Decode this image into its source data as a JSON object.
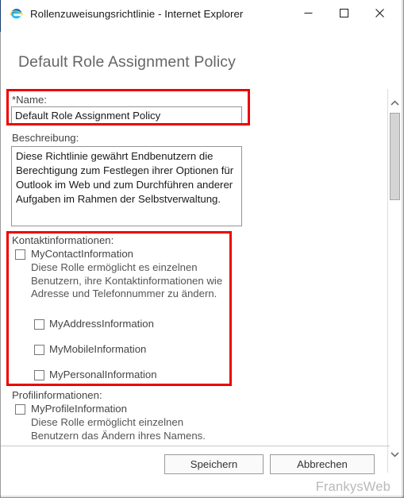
{
  "window": {
    "title": "Rollenzuweisungsrichtlinie - Internet Explorer",
    "icon": "internet-explorer-icon",
    "controls": {
      "minimize": "—",
      "maximize": "□",
      "close": "✕"
    }
  },
  "page": {
    "heading": "Default Role Assignment Policy"
  },
  "form": {
    "name": {
      "label": "*Name:",
      "value": "Default Role Assignment Policy",
      "placeholder": ""
    },
    "description": {
      "label": "Beschreibung:",
      "value": "Diese Richtlinie gewährt Endbenutzern die Berechtigung zum Festlegen ihrer Optionen für Outlook im Web und zum Durchführen anderer Aufgaben im Rahmen der Selbstverwaltung.",
      "placeholder": ""
    }
  },
  "sections": [
    {
      "label": "Kontaktinformationen:",
      "items": [
        {
          "name": "MyContactInformation",
          "checked": false,
          "description": "Diese Rolle ermöglicht es einzelnen Benutzern, ihre Kontaktinformationen wie Adresse und Telefonnummer zu ändern."
        },
        {
          "name": "MyAddressInformation",
          "checked": false,
          "description": ""
        },
        {
          "name": "MyMobileInformation",
          "checked": false,
          "description": ""
        },
        {
          "name": "MyPersonalInformation",
          "checked": false,
          "description": ""
        }
      ]
    },
    {
      "label": "Profilinformationen:",
      "items": [
        {
          "name": "MyProfileInformation",
          "checked": false,
          "description": "Diese Rolle ermöglicht einzelnen Benutzern das Ändern ihres Namens."
        }
      ]
    }
  ],
  "footer": {
    "save_label": "Speichern",
    "cancel_label": "Abbrechen",
    "watermark": "FrankysWeb"
  },
  "scrollbar": {
    "up_arrow": "⌃",
    "down_arrow": "⌄"
  },
  "annotations": {
    "highlight_color": "#ee0000",
    "boxes": [
      "name-field-highlight",
      "contact-information-highlight"
    ]
  }
}
